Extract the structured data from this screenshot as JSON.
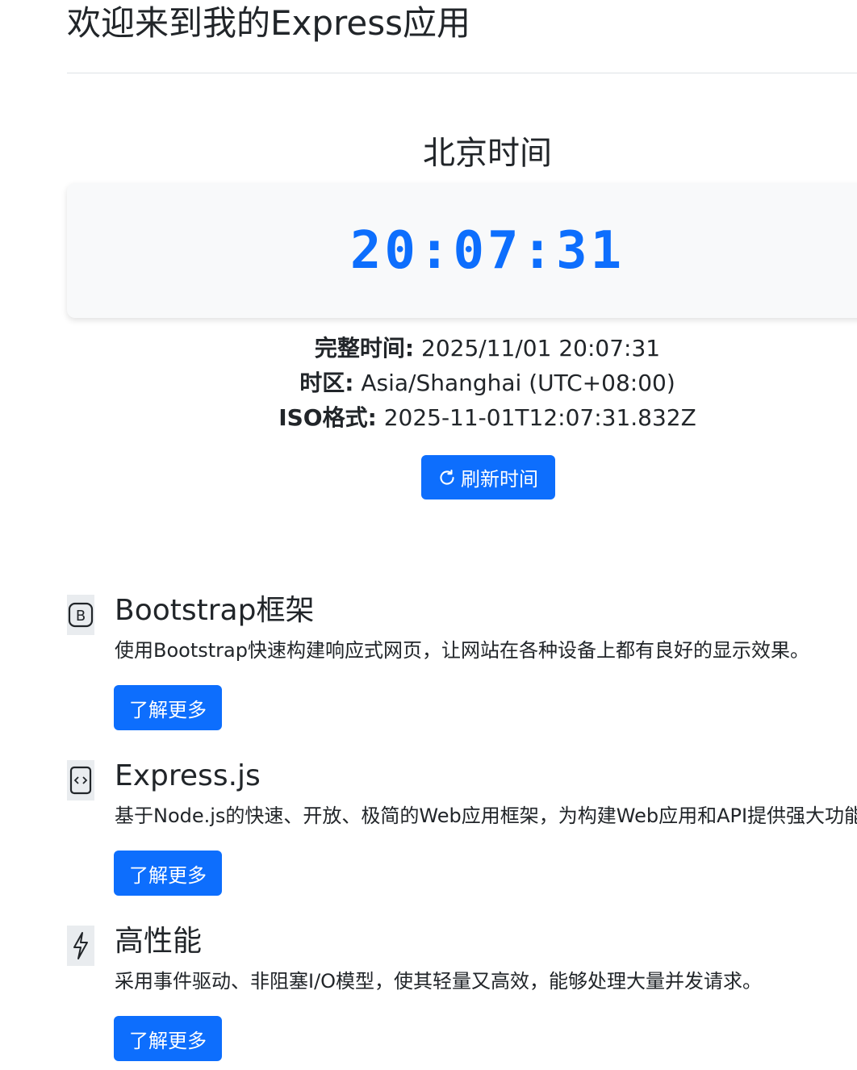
{
  "header": {
    "title": "欢迎来到我的Express应用"
  },
  "clock": {
    "heading": "北京时间",
    "time": "20:07:31",
    "full_label": "完整时间:",
    "full_value": "2025/11/01 20:07:31",
    "tz_label": "时区:",
    "tz_value": "Asia/Shanghai (UTC+08:00)",
    "iso_label": "ISO格式:",
    "iso_value": "2025-11-01T12:07:31.832Z",
    "refresh_label": "刷新时间",
    "refresh_icon": "arrow-clockwise-icon"
  },
  "features": [
    {
      "icon": "bootstrap-icon",
      "title": "Bootstrap框架",
      "description": "使用Bootstrap快速构建响应式网页，让网站在各种设备上都有良好的显示效果。",
      "button": "了解更多"
    },
    {
      "icon": "code-file-icon",
      "title": "Express.js",
      "description": "基于Node.js的快速、开放、极简的Web应用框架，为构建Web应用和API提供强大功能",
      "button": "了解更多"
    },
    {
      "icon": "lightning-icon",
      "title": "高性能",
      "description": "采用事件驱动、非阻塞I/O模型，使其轻量又高效，能够处理大量并发请求。",
      "button": "了解更多"
    }
  ],
  "colors": {
    "primary": "#0d6efd",
    "card_bg": "#f8f9fa",
    "icon_bg": "#e9ecef"
  }
}
